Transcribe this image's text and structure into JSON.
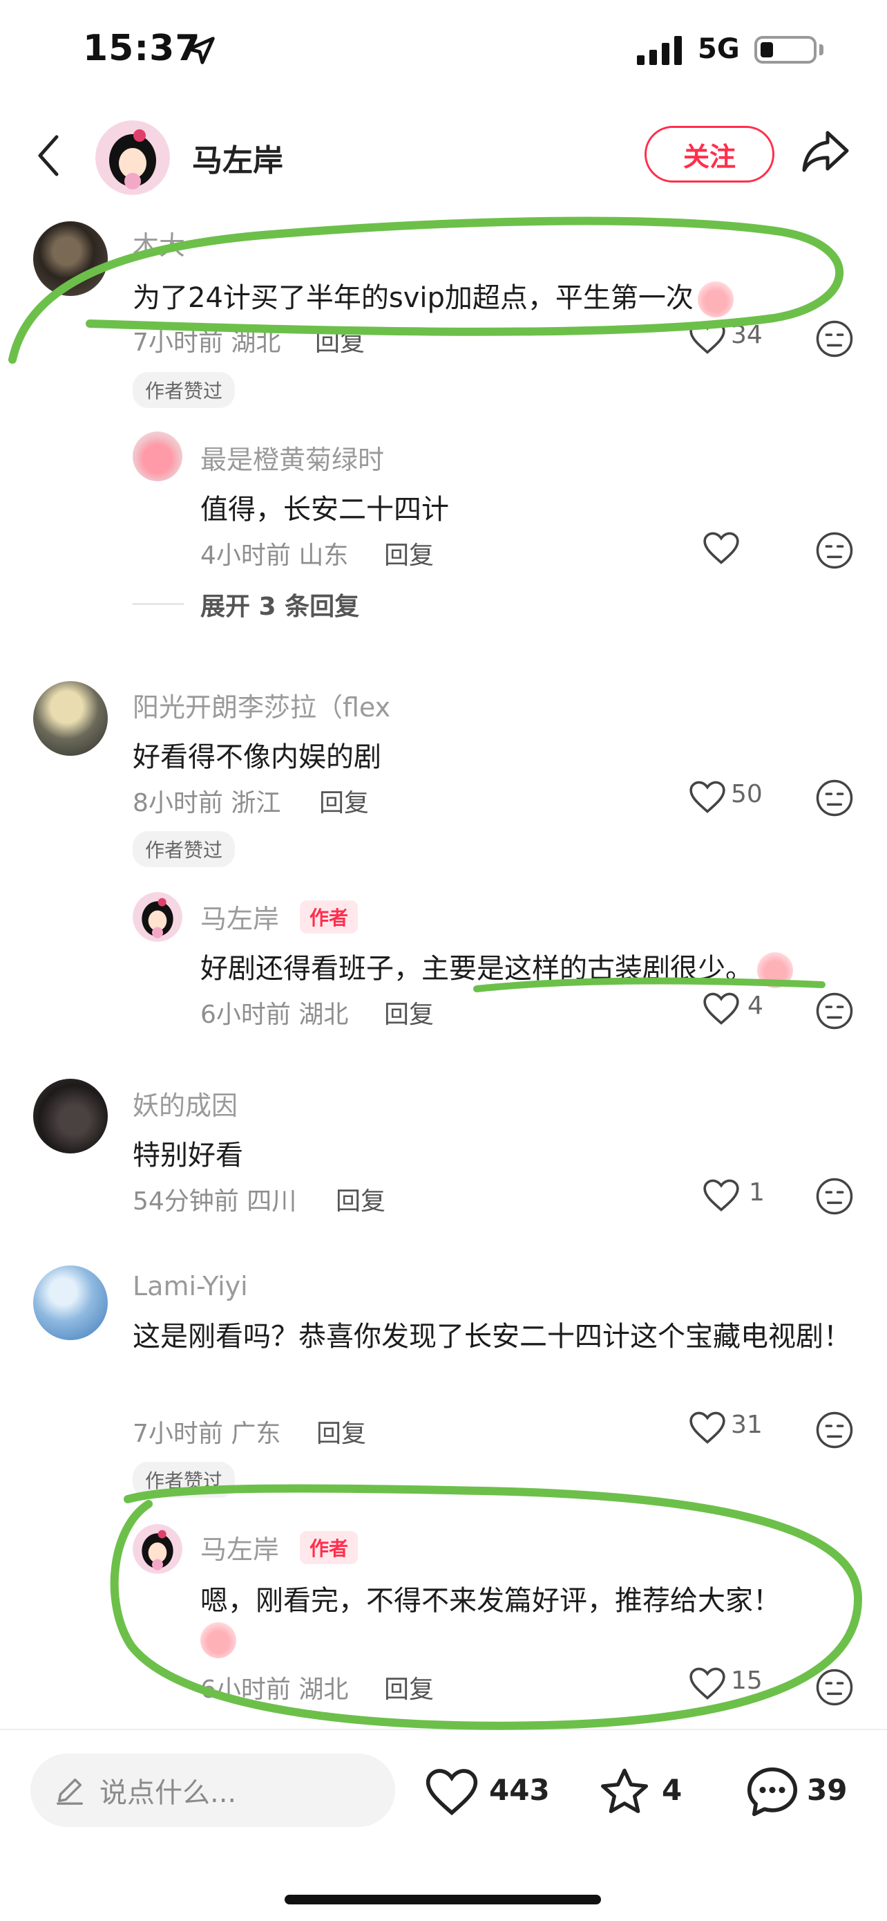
{
  "status_bar": {
    "time": "15:37",
    "network": "5G"
  },
  "header": {
    "username": "马左岸",
    "follow_label": "关注"
  },
  "comments": [
    {
      "author": "木大",
      "text": "为了24计买了半年的svip加超点，平生第一次",
      "time": "7小时前",
      "location": "湖北",
      "reply_label": "回复",
      "likes": "34",
      "liked_by_author": "作者赞过",
      "replies": [
        {
          "author": "最是橙黄菊绿时",
          "text": "值得，长安二十四计",
          "time": "4小时前",
          "location": "山东",
          "reply_label": "回复",
          "likes": ""
        }
      ],
      "expand_label": "展开 3 条回复"
    },
    {
      "author": "阳光开朗李莎拉（flex",
      "text": "好看得不像内娱的剧",
      "time": "8小时前",
      "location": "浙江",
      "reply_label": "回复",
      "likes": "50",
      "liked_by_author": "作者赞过",
      "replies": [
        {
          "author": "马左岸",
          "author_tag": "作者",
          "text": "好剧还得看班子，主要是这样的古装剧很少。",
          "time": "6小时前",
          "location": "湖北",
          "reply_label": "回复",
          "likes": "4"
        }
      ]
    },
    {
      "author": "妖的成因",
      "text": "特别好看",
      "time": "54分钟前",
      "location": "四川",
      "reply_label": "回复",
      "likes": "1"
    },
    {
      "author": "Lami-Yiyi",
      "text": "这是刚看吗？恭喜你发现了长安二十四计这个宝藏电视剧！",
      "time": "7小时前",
      "location": "广东",
      "reply_label": "回复",
      "likes": "31",
      "liked_by_author": "作者赞过",
      "replies": [
        {
          "author": "马左岸",
          "author_tag": "作者",
          "text": "嗯，刚看完，不得不来发篇好评，推荐给大家！",
          "time": "6小时前",
          "location": "湖北",
          "reply_label": "回复",
          "likes": "15"
        }
      ]
    }
  ],
  "bottom_bar": {
    "input_placeholder": "说点什么...",
    "like_count": "443",
    "star_count": "4",
    "comment_count": "39"
  },
  "colors": {
    "accent": "#ff2e4d",
    "annotation": "#6cc04a"
  }
}
